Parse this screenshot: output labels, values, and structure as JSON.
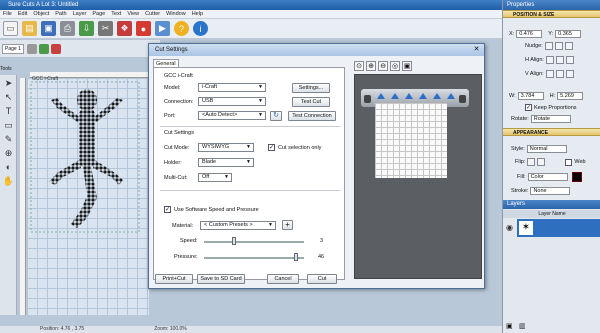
{
  "app": {
    "title": "Sure Cuts A Lot 3: Untitled"
  },
  "menu": [
    "File",
    "Edit",
    "Object",
    "Path",
    "Layer",
    "Page",
    "Text",
    "View",
    "Cutter",
    "Window",
    "Help"
  ],
  "toolbar": {
    "icons": [
      "new-icon",
      "open-icon",
      "save-icon",
      "print-icon",
      "import-icon",
      "cut-icon",
      "gift-icon",
      "apple-icon",
      "cut-dialog-icon",
      "help-icon",
      "info-icon"
    ]
  },
  "page_tab": "Page 1",
  "tools_label": "Tools",
  "canvas": {
    "mat_label": "GCC i-Craft"
  },
  "status": {
    "left": "Position: 4.76 , 3.75",
    "right": "Zoom: 100.0%"
  },
  "properties": {
    "title": "Properties",
    "position_section": "POSITION & SIZE",
    "x_label": "X:",
    "x_value": "0.476",
    "y_label": "Y:",
    "y_value": "0.365",
    "nudge_label": "Nudge:",
    "halign_label": "H Align:",
    "valign_label": "V Align:",
    "w_label": "W:",
    "w_value": "3.784",
    "h_label": "H:",
    "h_value": "5.269",
    "keep_proportions": "Keep Proportions",
    "rotate_label": "Rotate:",
    "rotate_value": "Rotate",
    "appearance_section": "APPEARANCE",
    "style_label": "Style:",
    "style_value": "Normal",
    "flip_label": "Flip:",
    "web_label": "Web",
    "fill_label": "Fill:",
    "fill_value": "Color",
    "stroke_label": "Stroke:",
    "stroke_value": "None"
  },
  "layers": {
    "title": "Layers",
    "header": "Layer Name",
    "row_label": ""
  },
  "dialog": {
    "title": "Cut Settings",
    "tab": "General",
    "cutter_name": "GCC i-Craft",
    "model_label": "Model:",
    "model_value": "i-Craft",
    "settings_button": "Settings...",
    "connection_label": "Connection:",
    "connection_value": "USB",
    "test_cut_button": "Test Cut",
    "port_label": "Port:",
    "port_value": "<Auto Detect>",
    "test_connection_button": "Test Connection",
    "cut_settings_header": "Cut Settings",
    "cut_mode_label": "Cut Mode:",
    "cut_mode_value": "WYSIWYG",
    "cut_selection_only": "Cut selection only",
    "holder_label": "Holder:",
    "holder_value": "Blade",
    "multicut_label": "Multi-Cut:",
    "multicut_value": "Off",
    "use_speed_pressure": "Use Software Speed and Pressure",
    "material_label": "Material:",
    "material_value": "< Custom Presets >",
    "speed_label": "Speed:",
    "speed_value": "3",
    "speed_fraction": 0.3,
    "pressure_label": "Pressure:",
    "pressure_value": "46",
    "pressure_fraction": 0.92,
    "print_cut_button": "Print+Cut",
    "save_sd_button": "Save to SD Card",
    "cancel_button": "Cancel",
    "cut_button": "Cut"
  }
}
